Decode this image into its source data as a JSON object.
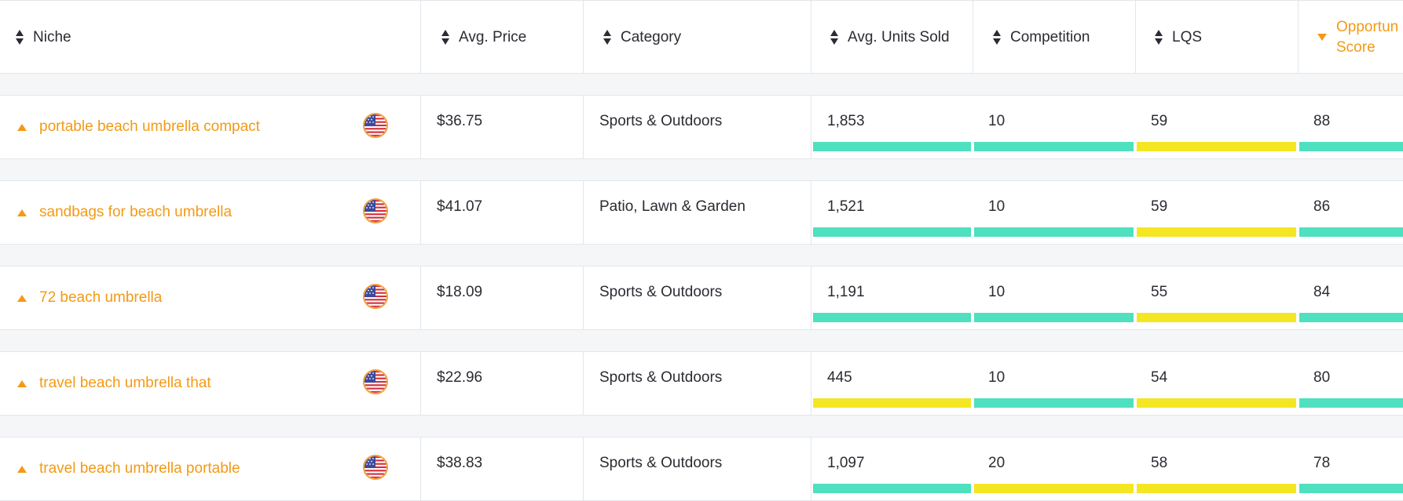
{
  "header": {
    "niche": "Niche",
    "avg_price": "Avg. Price",
    "category": "Category",
    "avg_units_sold": "Avg. Units Sold",
    "competition": "Competition",
    "lqs": "LQS",
    "opportunity_line1": "Opportun",
    "opportunity_line2": "Score"
  },
  "colors": {
    "accent": "#f39a14",
    "good": "#4fe0bf",
    "medium": "#f5e623"
  },
  "rows": [
    {
      "niche": "portable beach umbrella compact",
      "flag": "us-flag-icon",
      "price": "$36.75",
      "category": "Sports & Outdoors",
      "units": "1,853",
      "units_level": "good",
      "competition": "10",
      "competition_level": "good",
      "lqs": "59",
      "lqs_level": "medium",
      "opportunity": "88",
      "opportunity_level": "good"
    },
    {
      "niche": "sandbags for beach umbrella",
      "flag": "us-flag-icon",
      "price": "$41.07",
      "category": "Patio, Lawn & Garden",
      "units": "1,521",
      "units_level": "good",
      "competition": "10",
      "competition_level": "good",
      "lqs": "59",
      "lqs_level": "medium",
      "opportunity": "86",
      "opportunity_level": "good"
    },
    {
      "niche": "72 beach umbrella",
      "flag": "us-flag-icon",
      "price": "$18.09",
      "category": "Sports & Outdoors",
      "units": "1,191",
      "units_level": "good",
      "competition": "10",
      "competition_level": "good",
      "lqs": "55",
      "lqs_level": "medium",
      "opportunity": "84",
      "opportunity_level": "good"
    },
    {
      "niche": "travel beach umbrella that",
      "flag": "us-flag-icon",
      "price": "$22.96",
      "category": "Sports & Outdoors",
      "units": "445",
      "units_level": "medium",
      "competition": "10",
      "competition_level": "good",
      "lqs": "54",
      "lqs_level": "medium",
      "opportunity": "80",
      "opportunity_level": "good"
    },
    {
      "niche": "travel beach umbrella portable",
      "flag": "us-flag-icon",
      "price": "$38.83",
      "category": "Sports & Outdoors",
      "units": "1,097",
      "units_level": "good",
      "competition": "20",
      "competition_level": "medium",
      "lqs": "58",
      "lqs_level": "medium",
      "opportunity": "78",
      "opportunity_level": "good"
    }
  ]
}
